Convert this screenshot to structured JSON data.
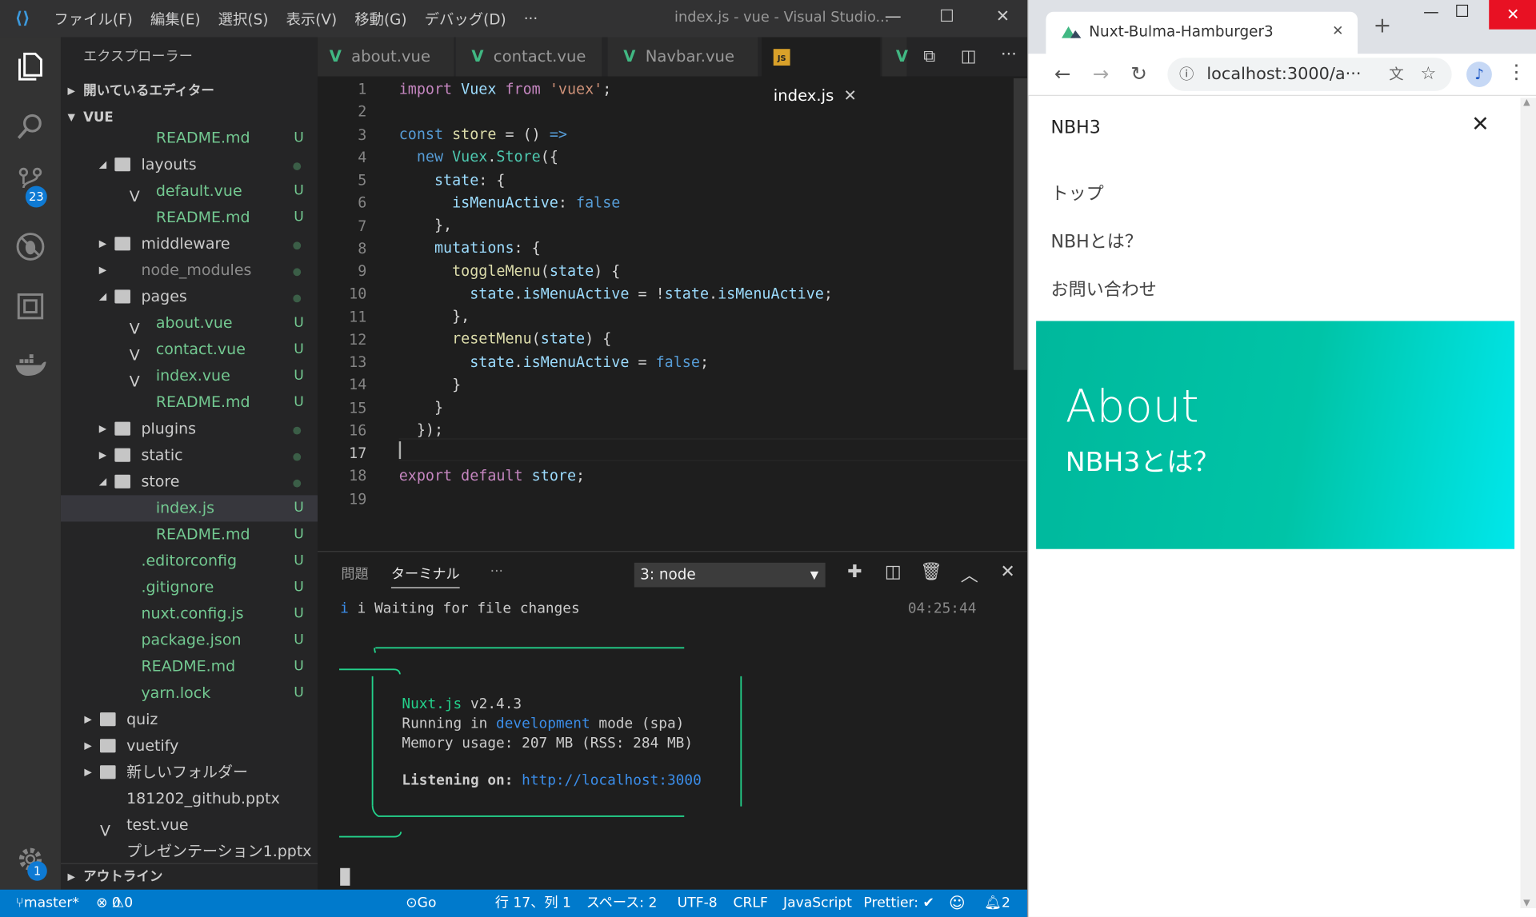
{
  "vscode": {
    "menu": [
      "ファイル(F)",
      "編集(E)",
      "選択(S)",
      "表示(V)",
      "移動(G)",
      "デバッグ(D)",
      "···"
    ],
    "window_title": "index.js - vue - Visual Studio...",
    "activity_badges": {
      "scm": "23",
      "settings": "1"
    },
    "explorer": {
      "title": "エクスプローラー",
      "open_editors": "開いているエディター",
      "root": "VUE",
      "outline": "アウトライン",
      "rows": [
        {
          "name": "README.md",
          "status": "U"
        },
        {
          "name": "layouts",
          "status": ""
        },
        {
          "name": "default.vue",
          "status": "U"
        },
        {
          "name": "README.md",
          "status": "U"
        },
        {
          "name": "middleware",
          "status": ""
        },
        {
          "name": "node_modules",
          "status": ""
        },
        {
          "name": "pages",
          "status": ""
        },
        {
          "name": "about.vue",
          "status": "U"
        },
        {
          "name": "contact.vue",
          "status": "U"
        },
        {
          "name": "index.vue",
          "status": "U"
        },
        {
          "name": "README.md",
          "status": "U"
        },
        {
          "name": "plugins",
          "status": ""
        },
        {
          "name": "static",
          "status": ""
        },
        {
          "name": "store",
          "status": ""
        },
        {
          "name": "index.js",
          "status": "U"
        },
        {
          "name": "README.md",
          "status": "U"
        },
        {
          "name": ".editorconfig",
          "status": "U"
        },
        {
          "name": ".gitignore",
          "status": "U"
        },
        {
          "name": "nuxt.config.js",
          "status": "U"
        },
        {
          "name": "package.json",
          "status": "U"
        },
        {
          "name": "README.md",
          "status": "U"
        },
        {
          "name": "yarn.lock",
          "status": "U"
        },
        {
          "name": "quiz",
          "status": ""
        },
        {
          "name": "vuetify",
          "status": ""
        },
        {
          "name": "新しいフォルダー",
          "status": ""
        },
        {
          "name": "181202_github.pptx",
          "status": ""
        },
        {
          "name": "test.vue",
          "status": ""
        },
        {
          "name": "プレゼンテーション1.pptx",
          "status": ""
        }
      ]
    },
    "tabs": [
      "about.vue",
      "contact.vue",
      "Navbar.vue",
      "index.js"
    ],
    "code": {
      "line_numbers": [
        "1",
        "2",
        "3",
        "4",
        "5",
        "6",
        "7",
        "8",
        "9",
        "10",
        "11",
        "12",
        "13",
        "14",
        "15",
        "16",
        "17",
        "18",
        "19"
      ],
      "current_line": "17"
    },
    "panel": {
      "tabs": [
        "問題",
        "ターミナル",
        "···"
      ],
      "terminal_select": "3: node",
      "status_line": "i Waiting for file changes",
      "time": "04:25:44",
      "nuxt_version_label": "Nuxt.js",
      "nuxt_version": "v2.4.3",
      "running_line_pre": "Running in ",
      "running_mode": "development",
      "running_line_post": " mode (spa)",
      "memory": "Memory usage: 207 MB (RSS: 284 MB)",
      "listening_label": "Listening on:",
      "listening_url": "http://localhost:3000"
    },
    "status": {
      "branch": "master*",
      "errors": "0",
      "warnings": "0",
      "golive": "Go Live",
      "position": "行 17、列 1",
      "spaces": "スペース: 2",
      "encoding": "UTF-8",
      "eol": "CRLF",
      "language": "JavaScript",
      "prettier": "Prettier: ✔",
      "notifications": "2"
    }
  },
  "browser": {
    "tab_title": "Nuxt-Bulma-Hamburger3",
    "url": "localhost:3000/a···",
    "brand": "NBH3",
    "menu": [
      "トップ",
      "NBHとは？",
      "お問い合わせ"
    ],
    "hero_title": "About",
    "hero_subtitle": "NBH3とは？"
  },
  "colors": {
    "status_bar": "#007acc",
    "hero_start": "#00b89c",
    "hero_end": "#00e7eb",
    "vue_green": "#41b883"
  }
}
